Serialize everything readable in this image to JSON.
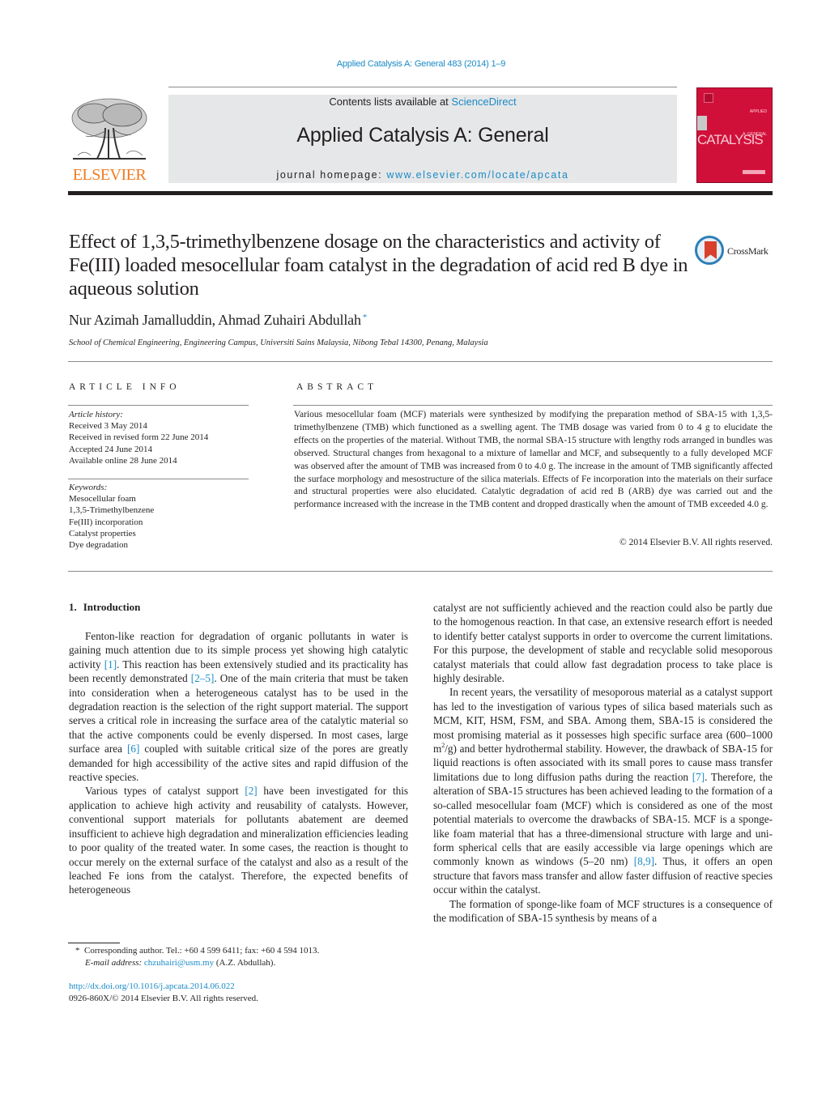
{
  "header": {
    "running_head": "Applied Catalysis A: General 483 (2014) 1–9",
    "contents_prefix": "Contents lists available at ",
    "contents_link": "ScienceDirect",
    "journal_title": "Applied Catalysis A: General",
    "homepage_prefix": "journal homepage: ",
    "homepage_link": "www.elsevier.com/locate/apcata",
    "publisher_logo_text": "ELSEVIER",
    "cover": {
      "title": "CATALYSIS",
      "top_text": "APPLIED",
      "sub_text": "A: GENERAL",
      "color": "#d1103a"
    },
    "crossmark_label": "CrossMark"
  },
  "article": {
    "title": "Effect of 1,3,5-trimethylbenzene dosage on the characteristics and activity of Fe(III) loaded mesocellular foam catalyst in the degradation of acid red B dye in aqueous solution",
    "authors": "Nur Azimah Jamalluddin, Ahmad Zuhairi Abdullah",
    "corresponding_mark": "*",
    "affiliation": "School of Chemical Engineering, Engineering Campus, Universiti Sains Malaysia, Nibong Tebal 14300, Penang, Malaysia"
  },
  "article_info": {
    "heading": "ARTICLE INFO",
    "history_label": "Article history:",
    "history": [
      "Received 3 May 2014",
      "Received in revised form 22 June 2014",
      "Accepted 24 June 2014",
      "Available online 28 June 2014"
    ],
    "keywords_label": "Keywords:",
    "keywords": [
      "Mesocellular foam",
      "1,3,5-Trimethylbenzene",
      "Fe(III) incorporation",
      "Catalyst properties",
      "Dye degradation"
    ]
  },
  "abstract": {
    "heading": "ABSTRACT",
    "text": "Various mesocellular foam (MCF) materials were synthesized by modifying the preparation method of SBA-15 with 1,3,5-trimethylbenzene (TMB) which functioned as a swelling agent. The TMB dosage was varied from 0 to 4 g to elucidate the effects on the properties of the material. Without TMB, the normal SBA-15 structure with lengthy rods arranged in bundles was observed. Structural changes from hexagonal to a mixture of lamellar and MCF, and subsequently to a fully developed MCF was observed after the amount of TMB was increased from 0 to 4.0 g. The increase in the amount of TMB significantly affected the surface morphology and mesostructure of the silica materials. Effects of Fe incorporation into the materials on their surface and structural properties were also elucidated. Catalytic degradation of acid red B (ARB) dye was carried out and the performance increased with the increase in the TMB content and dropped drastically when the amount of TMB exceeded 4.0 g.",
    "copyright": "© 2014 Elsevier B.V. All rights reserved."
  },
  "introduction": {
    "number": "1.",
    "heading": "Introduction",
    "p1": {
      "a": "Fenton-like reaction for degradation of organic pollutants in water is gaining much attention due to its simple process yet show­ing high catalytic activity ",
      "ref1": "[1]",
      "b": ". This reaction has been extensively studied and its practicality has been recently demonstrated ",
      "ref2": "[2–5]",
      "c": ". One of the main criteria that must be taken into consideration when a heterogeneous catalyst has to be used in the degradation reaction is the selection of the right support material. The support serves a critical role in increasing the surface area of the catalytic material so that the active components could be evenly dispersed. In most cases, large surface area ",
      "ref3": "[6]",
      "d": " coupled with suitable critical size of the pores are greatly demanded for high accessibility of the active sites and rapid diffusion of the reactive species."
    },
    "p2": {
      "a": "Various types of catalyst support ",
      "ref1": "[2]",
      "b": " have been investigated for this application to achieve high activity and reusability of catalysts. However, conventional support materials for pollutants abatement are deemed insufficient to achieve high degradation and mineral­ization efficiencies leading to poor quality of the treated water. In some cases, the reaction is thought to occur merely on the external surface of the catalyst and also as a result of the leached Fe ions from the catalyst. Therefore, the expected benefits of heterogeneous catalyst are not sufficiently achieved and the reaction could also be partly due to the homogenous reaction. In that case, an exten­sive research effort is needed to identify better catalyst supports in order to overcome the current limitations. For this purpose, the development of stable and recyclable solid mesoporous catalyst materials that could allow fast degradation process to take place is highly desirable."
    },
    "p3": {
      "a": "In recent years, the versatility of mesoporous material as a cata­lyst support has led to the investigation of various types of silica based materials such as MCM, KIT, HSM, FSM, and SBA. Among them, SBA-15 is considered the most promising material as it possesses high specific surface area (600–1000 m",
      "sup": "2",
      "b": "/g) and better hydrothermal stability. However, the drawback of SBA-15 for liq­uid reactions is often associated with its small pores to cause mass transfer limitations due to long diffusion paths during the reac­tion ",
      "ref1": "[7]",
      "c": ". Therefore, the alteration of SBA-15 structures has been achieved leading to the formation of a so-called mesocellular foam (MCF) which is considered as one of the most potential materials to overcome the drawbacks of SBA-15. MCF is a sponge-like foam material that has a three-dimensional structure with large and uni­form spherical cells that are easily accessible via large openings which are commonly known as windows (5–20 nm) ",
      "ref2": "[8,9]",
      "d": ". Thus, it offers an open structure that favors mass transfer and allow faster diffusion of reactive species occur within the catalyst."
    },
    "p4": {
      "a": "The formation of sponge-like foam of MCF structures is a con­sequence of the modification of SBA-15 synthesis by means of a"
    }
  },
  "footnote": {
    "mark": "*",
    "text": "Corresponding author. Tel.: +60 4 599 6411; fax: +60 4 594 1013.",
    "email_label": "E-mail address:",
    "email": "chzuhairi@usm.my",
    "email_suffix": " (A.Z. Abdullah)."
  },
  "doi": {
    "link": "http://dx.doi.org/10.1016/j.apcata.2014.06.022",
    "issn_line": "0926-860X/© 2014 Elsevier B.V. All rights reserved."
  },
  "colors": {
    "link": "#1a8ac7",
    "elsevier_orange": "#f07c22",
    "masthead_bg": "#e6e7e8"
  }
}
